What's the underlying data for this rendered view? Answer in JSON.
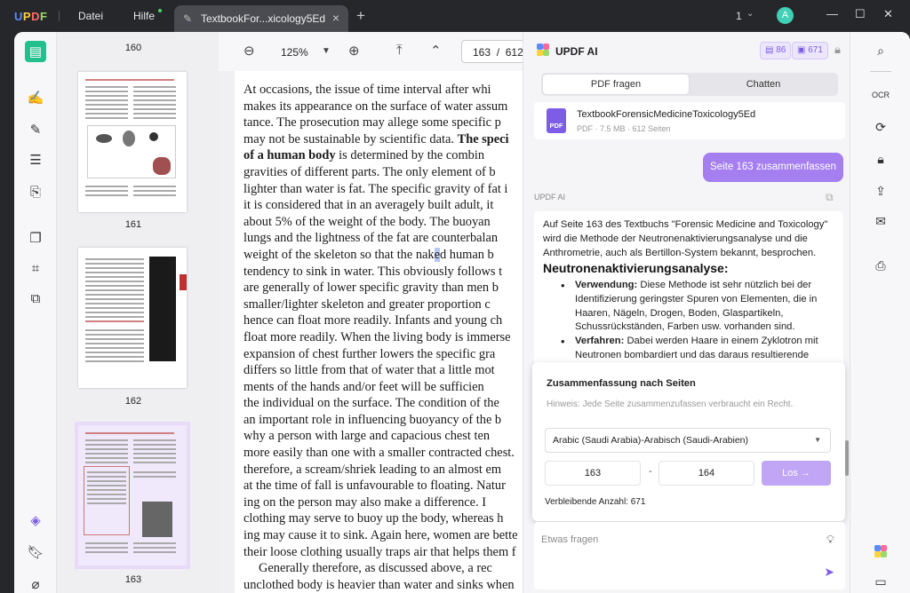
{
  "app": {
    "logo": "UPDF"
  },
  "menu": {
    "file": "Datei",
    "help": "Hilfe"
  },
  "tab": {
    "title": "TextbookFor...xicology5Ed"
  },
  "titlebar": {
    "page_count": "1",
    "avatar_letter": "A"
  },
  "thumbnails": [
    {
      "label": "160"
    },
    {
      "label": "161"
    },
    {
      "label": "162"
    },
    {
      "label": "163",
      "selected": true
    }
  ],
  "toolbar": {
    "zoom": "125%",
    "current_page": "163",
    "separator": "/",
    "total_pages": "612"
  },
  "document": {
    "lines": [
      "At occasions, the issue of time interval after whi",
      "makes its appearance on the surface of water assum",
      "tance. The prosecution may allege some specific p",
      "may not be sustainable by scientific data.",
      "of a human body",
      "gravities of different parts. The only element of b",
      "lighter than water is fat. The specific gravity of fat i",
      "it is considered that in an averagely built adult, it",
      "about 5% of the weight of the body. The buoyan",
      "lungs and the lightness of the fat are counterbalan",
      "weight of the skeleton so that the nak",
      "tendency to sink in water. This obviously follows t",
      "are generally of lower specific gravity than men b",
      "smaller/lighter skeleton and greater proportion c",
      "hence can float more readily. Infants and young ch",
      "float more readily. When the living body is immerse",
      "expansion of chest further lowers the specific gra",
      "differs so little from that of water that a little mot",
      "ments of the hands and/or feet will be sufficien",
      "the individual on the surface. The condition of the",
      "an important role in influencing buoyancy of the b",
      "why a person with large and capacious chest ten",
      "more easily than one with a smaller contracted chest.",
      "therefore, a scream/shriek leading to an almost em",
      "at the time of fall is unfavourable to floating. Natur",
      "ing on the person may also make a difference. I",
      "clothing may serve to buoy up the body, whereas h",
      "ing may cause it to sink. Again here, women are bette",
      "their loose clothing usually traps air that helps them f",
      "Generally therefore, as discussed above, a rec",
      "unclothed body is heavier than water and sinks when"
    ],
    "bold_1": "The speci",
    "rest_5": " is determined by the combin",
    "highlight": "e",
    "rest_11": "d human b"
  },
  "ai_panel": {
    "title": "UPDF AI",
    "credits": [
      {
        "icon": "doc-credit-icon",
        "value": "86"
      },
      {
        "icon": "chat-credit-icon",
        "value": "671"
      }
    ],
    "tabs": {
      "pdf": "PDF fragen",
      "chat": "Chatten"
    },
    "file": {
      "name": "TextbookForensicMedicineToxicology5Ed",
      "meta": "PDF · 7.5 MB · 612 Seiten",
      "icon_label": "PDF"
    },
    "user_message": "Seite 163 zusammenfassen",
    "ai_label": "UPDF AI",
    "answer": {
      "intro": "Auf Seite 163 des Textbuchs \"Forensic Medicine and Toxicology\" wird die Methode der Neutronenaktivierungsanalyse und die Anthrometrie, auch als Bertillon-System bekannt, besprochen.",
      "heading": "Neutronenaktivierungsanalyse:",
      "bullets": [
        {
          "term": "Verwendung:",
          "text": " Diese Methode ist sehr nützlich bei der Identifizierung geringster Spuren von Elementen, die in Haaren, Nägeln, Drogen, Boden, Glaspartikeln, Schussrückständen, Farben usw. vorhanden sind."
        },
        {
          "term": "Verfahren:",
          "text": " Dabei werden Haare in einem Zyklotron mit Neutronen bombardiert und das daraus resultierende"
        }
      ]
    },
    "summary": {
      "title": "Zusammenfassung nach Seiten",
      "hint": "Hinweis: Jede Seite zusammenzufassen verbraucht ein Recht.",
      "language": "Arabic (Saudi Arabia)-Arabisch (Saudi-Arabien)",
      "from": "163",
      "dash": "-",
      "to": "164",
      "go": "Los →",
      "remaining": "Verbleibende Anzahl: 671"
    },
    "ask_placeholder": "Etwas fragen"
  },
  "colors": {
    "accent": "#7d5ce6",
    "user_bubble": "#a57ff0",
    "active_tool": "#22c08c"
  }
}
